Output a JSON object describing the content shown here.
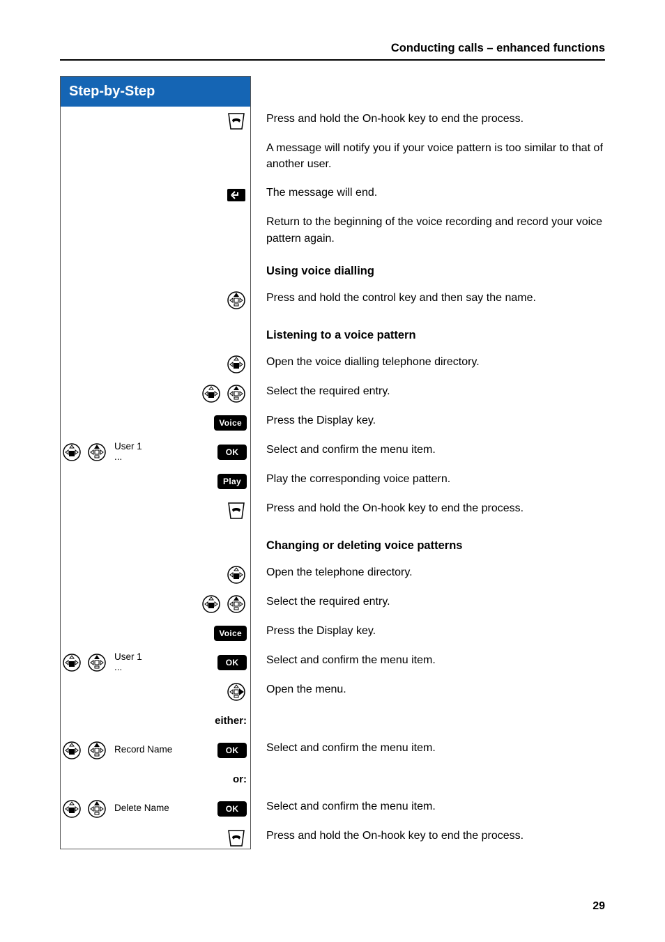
{
  "header": {
    "title": "Conducting calls – enhanced functions"
  },
  "sidebar": {
    "title": "Step-by-Step"
  },
  "steps": {
    "endProcess1": "Press and hold the On-hook key to end the process.",
    "notifyMsg": "A message will notify you if your voice pattern is too similar to that of another user.",
    "msgWillEnd": "The message will end.",
    "returnBegin": "Return to the beginning of the voice recording and record your voice pattern again.",
    "h_usingVoice": "Using voice dialling",
    "pressHoldControl": "Press and hold the control key and then say the name.",
    "h_listeningPattern": "Listening to a voice pattern",
    "openVoiceDir": "Open the voice dialling telephone directory.",
    "selectEntry1": "Select the required entry.",
    "pressDisplay1": "Press the Display key.",
    "selectConfirm1": "Select and confirm the menu item.",
    "playPattern": "Play the corresponding voice pattern.",
    "endProcess2": "Press and hold the On-hook key to end the process.",
    "h_changeDelete": "Changing or deleting voice patterns",
    "openTelDir": "Open the telephone directory.",
    "selectEntry2": "Select the required entry.",
    "pressDisplay2": "Press the Display key.",
    "selectConfirm2": "Select and confirm the menu item.",
    "openMenu": "Open the menu.",
    "eitherLabel": "either:",
    "selectConfirm3": "Select and confirm the menu item.",
    "orLabel": "or:",
    "selectConfirm4": "Select and confirm the menu item.",
    "endProcess3": "Press and hold the On-hook key to end the process."
  },
  "buttons": {
    "voice": "Voice",
    "ok": "OK",
    "play": "Play"
  },
  "labels": {
    "user1": "User 1",
    "ellipsis": "...",
    "recordName": "Record Name",
    "deleteName": "Delete Name"
  },
  "pageNumber": "29"
}
